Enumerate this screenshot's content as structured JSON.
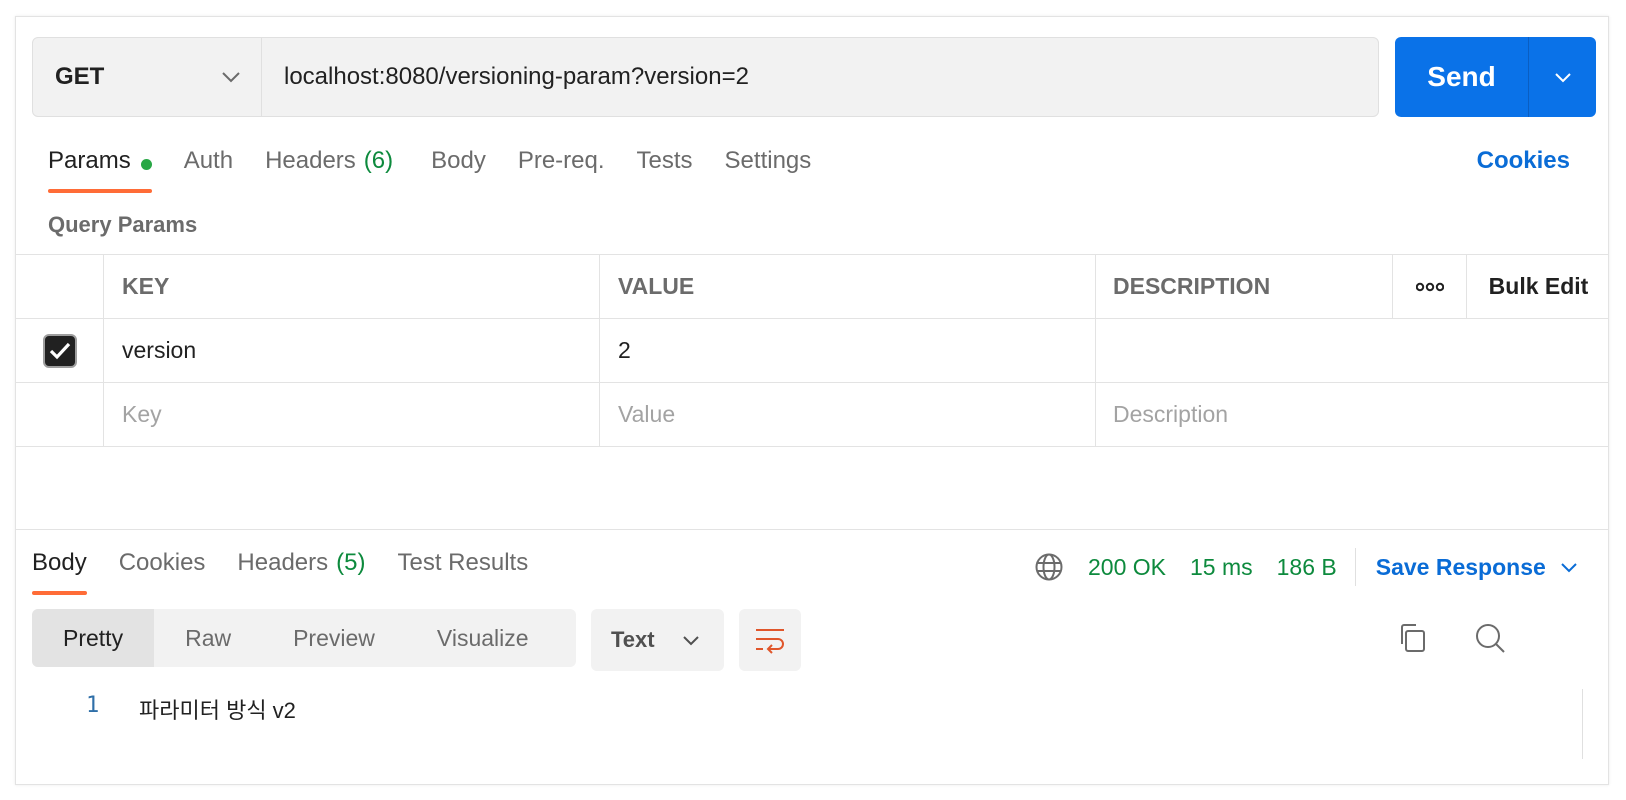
{
  "request": {
    "method": "GET",
    "url": "localhost:8080/versioning-param?version=2",
    "send_label": "Send"
  },
  "request_tabs": [
    {
      "label": "Params",
      "active": true,
      "dot": true
    },
    {
      "label": "Auth"
    },
    {
      "label": "Headers",
      "count": "(6)"
    },
    {
      "label": "Body"
    },
    {
      "label": "Pre-req."
    },
    {
      "label": "Tests"
    },
    {
      "label": "Settings"
    }
  ],
  "cookies_label": "Cookies",
  "query_params": {
    "section_label": "Query Params",
    "headers": {
      "key": "KEY",
      "value": "VALUE",
      "description": "DESCRIPTION",
      "more": "ooo",
      "bulk_edit": "Bulk Edit"
    },
    "rows": [
      {
        "checked": true,
        "key": "version",
        "value": "2",
        "description": ""
      }
    ],
    "placeholders": {
      "key": "Key",
      "value": "Value",
      "description": "Description"
    }
  },
  "response": {
    "tabs": [
      {
        "label": "Body",
        "active": true
      },
      {
        "label": "Cookies"
      },
      {
        "label": "Headers",
        "count": "(5)"
      },
      {
        "label": "Test Results"
      }
    ],
    "status": "200 OK",
    "time": "15 ms",
    "size": "186 B",
    "save_label": "Save Response",
    "view_modes": [
      "Pretty",
      "Raw",
      "Preview",
      "Visualize"
    ],
    "format": "Text",
    "lines": [
      {
        "no": "1",
        "text": "파라미터 방식 v2"
      }
    ]
  },
  "colors": {
    "accent": "#0a72e8",
    "tab_underline": "#ff6c37",
    "status_green": "#0d8a3d",
    "link_blue": "#0a6cd6"
  }
}
